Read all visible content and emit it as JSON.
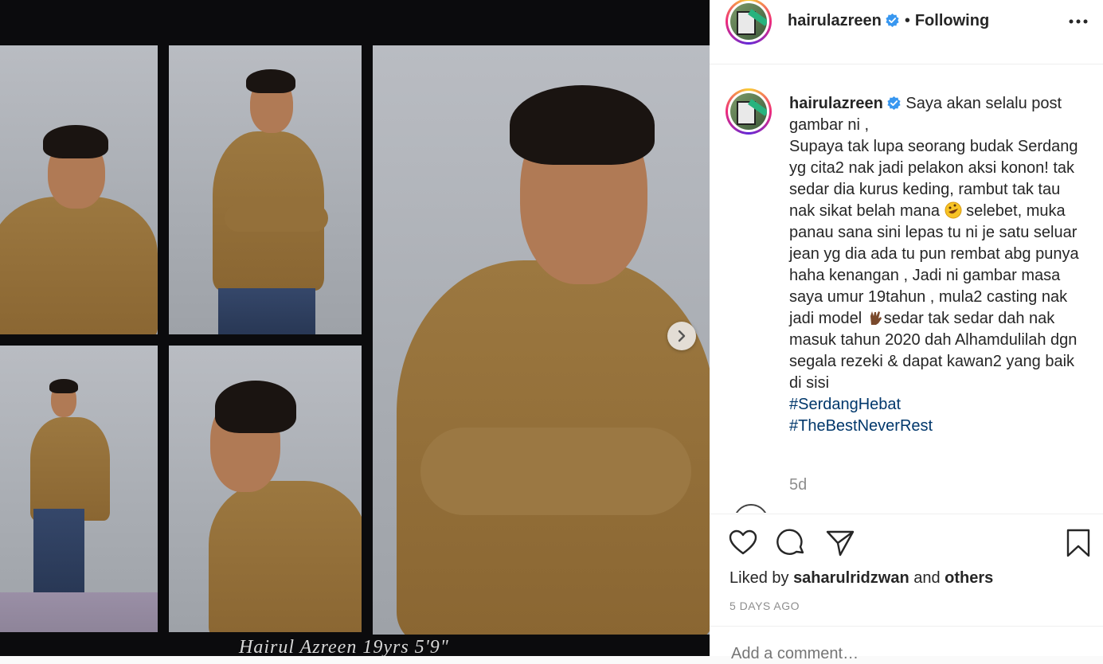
{
  "post": {
    "username": "hairulazreen",
    "follow_separator": "•",
    "follow_label": "Following",
    "caption_username": "hairulazreen",
    "caption_part1": "Saya akan selalu post gambar ni ,\nSupaya tak lupa seorang budak Serdang yg cita2 nak jadi pelakon aksi konon! tak sedar dia kurus keding, rambut tak tau nak sikat belah mana ",
    "caption_part2": " selebet, muka panau sana sini lepas tu ni je satu seluar jean yg dia ada tu pun rembat abg punya haha kenangan , Jadi ni gambar masa saya umur 19tahun , mula2 casting nak jadi model ",
    "caption_part3": "sedar tak sedar dah nak masuk tahun 2020 dah Alhamdulilah dgn segala rezeki & dapat kawan2 yang baik di sisi",
    "hashtags": [
      "#SerdangHebat",
      "#TheBestNeverRest"
    ],
    "timestamp": "5d",
    "liked_by_prefix": "Liked by",
    "liked_by_user": "saharulridzwan",
    "liked_by_and": "and",
    "liked_by_others": "others",
    "date": "5 DAYS AGO",
    "add_comment_placeholder": "Add a comment…"
  },
  "photo": {
    "caption": "Hairul Azreen 19yrs 5'9\""
  },
  "icons": {
    "avatar": "profile-avatar",
    "verified": "verified-badge-icon",
    "more": "more-options-icon",
    "next": "chevron-right-icon",
    "like": "heart-icon",
    "comment": "comment-bubble-icon",
    "share": "paper-plane-icon",
    "save": "bookmark-icon",
    "emoji1": "rolling-laughing-emoji",
    "emoji2": "vulcan-salute-emoji"
  },
  "colors": {
    "verified": "#3897f0",
    "hashtag": "#00376b",
    "muted": "#8e8e8e"
  }
}
